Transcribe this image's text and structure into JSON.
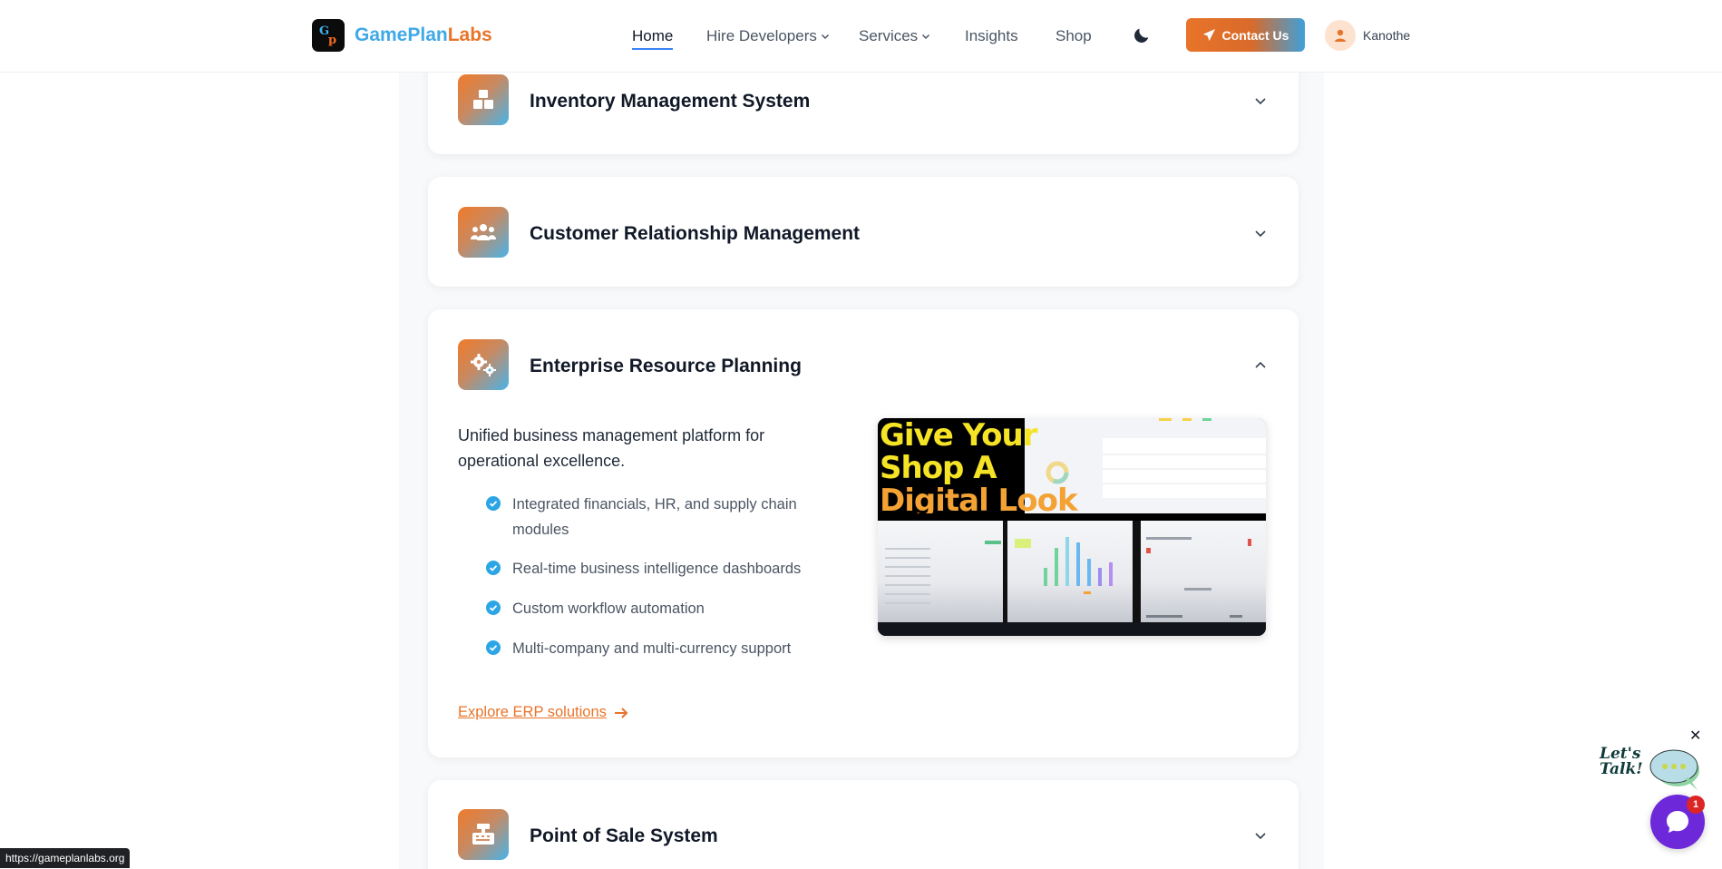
{
  "header": {
    "logo_text_part1": "GamePlan",
    "logo_text_part2": "Labs",
    "logo_mark_g": "G",
    "logo_mark_p": "p",
    "nav": {
      "home": "Home",
      "hire_developers": "Hire Developers",
      "services": "Services",
      "insights": "Insights",
      "shop": "Shop"
    },
    "contact_button": "Contact Us",
    "username": "Kanothe"
  },
  "cards": [
    {
      "title": "Inventory Management System",
      "icon": "boxes-icon",
      "expanded": false
    },
    {
      "title": "Customer Relationship Management",
      "icon": "users-icon",
      "expanded": false
    },
    {
      "title": "Enterprise Resource Planning",
      "icon": "cogs-icon",
      "expanded": true,
      "description": "Unified business management platform for operational excellence.",
      "features": [
        "Integrated financials, HR, and supply chain modules",
        "Real-time business intelligence dashboards",
        "Custom workflow automation",
        "Multi-company and multi-currency support"
      ],
      "link": "Explore ERP solutions",
      "promo_lines": [
        "Give Your",
        "Shop A",
        "Digital Look"
      ]
    },
    {
      "title": "Point of Sale System",
      "icon": "cash-register-icon",
      "expanded": false
    }
  ],
  "chat": {
    "badge_count": "1",
    "close": "✕",
    "lets_talk_line1": "Let's",
    "lets_talk_line2": "Talk!"
  },
  "status_bar_url": "https://gameplanlabs.org",
  "colors": {
    "accent_orange": "#e8742a",
    "accent_blue": "#3fa9e8",
    "chat_purple": "#6d28d9",
    "check_blue": "#2ba5e6"
  }
}
